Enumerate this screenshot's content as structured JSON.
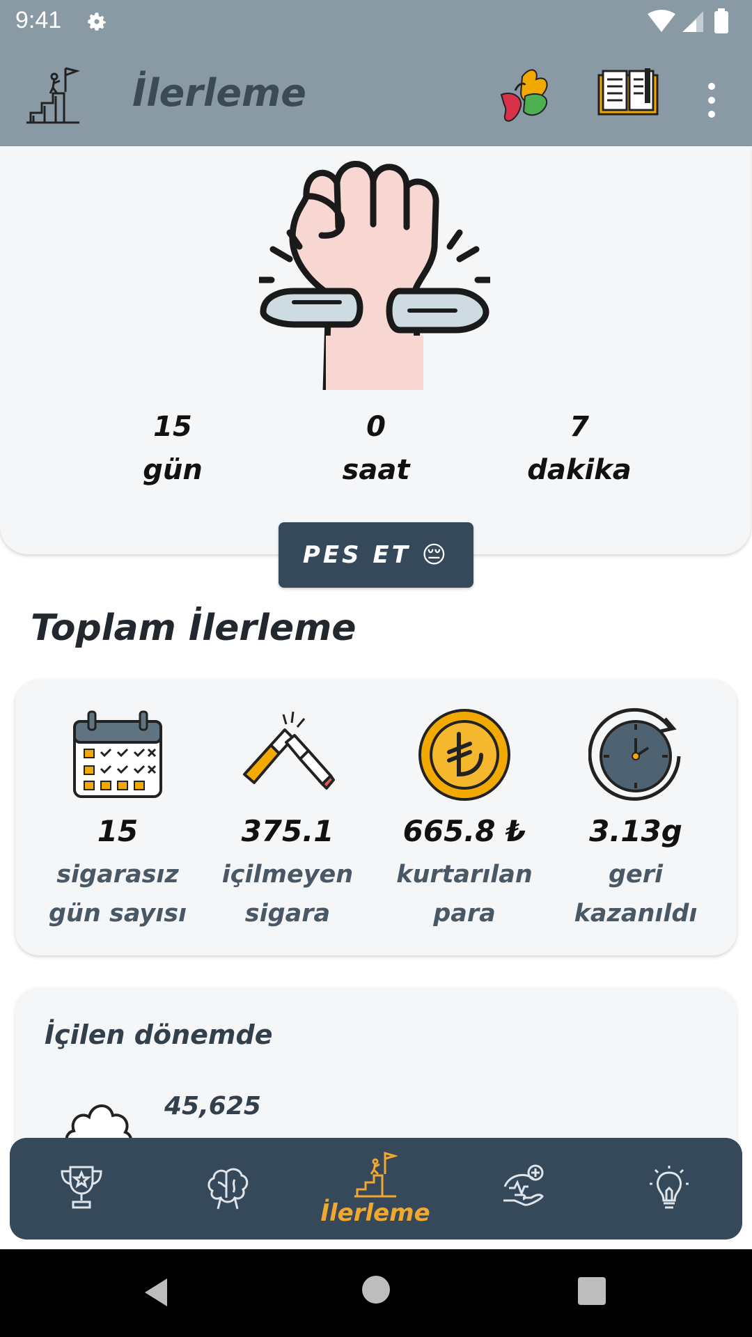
{
  "status_bar": {
    "time": "9:41"
  },
  "app_bar": {
    "title": "İlerleme"
  },
  "timer": {
    "days_value": "15",
    "days_unit": "gün",
    "hours_value": "0",
    "hours_unit": "saat",
    "minutes_value": "7",
    "minutes_unit": "dakika"
  },
  "give_up_button": "PES ET 😔",
  "total_progress": {
    "title": "Toplam İlerleme",
    "stats": [
      {
        "value": "15",
        "label_line1": "sigarasız",
        "label_line2": "gün sayısı",
        "icon": "calendar-icon"
      },
      {
        "value": "375.1",
        "label_line1": "içilmeyen",
        "label_line2": "sigara",
        "icon": "broken-cigarette-icon"
      },
      {
        "value": "665.8 ₺",
        "label_line1": "kurtarılan",
        "label_line2": "para",
        "icon": "lira-coin-icon"
      },
      {
        "value": "3.13g",
        "label_line1": "geri",
        "label_line2": "kazanıldı",
        "icon": "clock-icon"
      }
    ]
  },
  "smoked_period": {
    "title": "İçilen dönemde",
    "value": "45,625",
    "icon": "smoke-cloud-icon"
  },
  "bottom_nav": {
    "active_label": "İlerleme",
    "items": [
      "trophy-icon",
      "brain-icon",
      "progress-climb-icon",
      "health-hand-icon",
      "lightbulb-icon"
    ]
  },
  "colors": {
    "app_bar": "#8a9aa4",
    "dark_slate": "#36495a",
    "accent": "#f0a830",
    "card_bg": "#f4f6f8"
  }
}
